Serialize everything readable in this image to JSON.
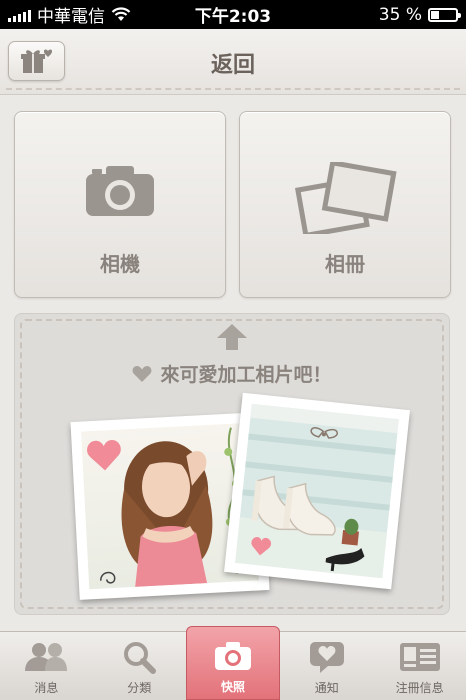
{
  "status_bar": {
    "carrier": "中華電信",
    "time": "下午2:03",
    "battery_percent": "35 %",
    "battery_level": 0.35
  },
  "nav": {
    "title": "返回",
    "gift_icon": "gift-icon"
  },
  "options": [
    {
      "label": "相機",
      "icon": "camera-icon"
    },
    {
      "label": "相冊",
      "icon": "photo-album-icon"
    }
  ],
  "promo": {
    "text": "來可愛加工相片吧！",
    "icons": [
      "up-arrow-icon",
      "heart-icon"
    ]
  },
  "tabs": [
    {
      "label": "消息",
      "icon": "people-icon"
    },
    {
      "label": "分類",
      "icon": "search-icon"
    },
    {
      "label": "快照",
      "icon": "camera-icon",
      "active": true
    },
    {
      "label": "通知",
      "icon": "speech-heart-icon"
    },
    {
      "label": "注冊信息",
      "icon": "id-card-icon"
    }
  ],
  "colors": {
    "accent": "#e3727a",
    "background": "#ebe9e6",
    "text": "#8a837d"
  }
}
